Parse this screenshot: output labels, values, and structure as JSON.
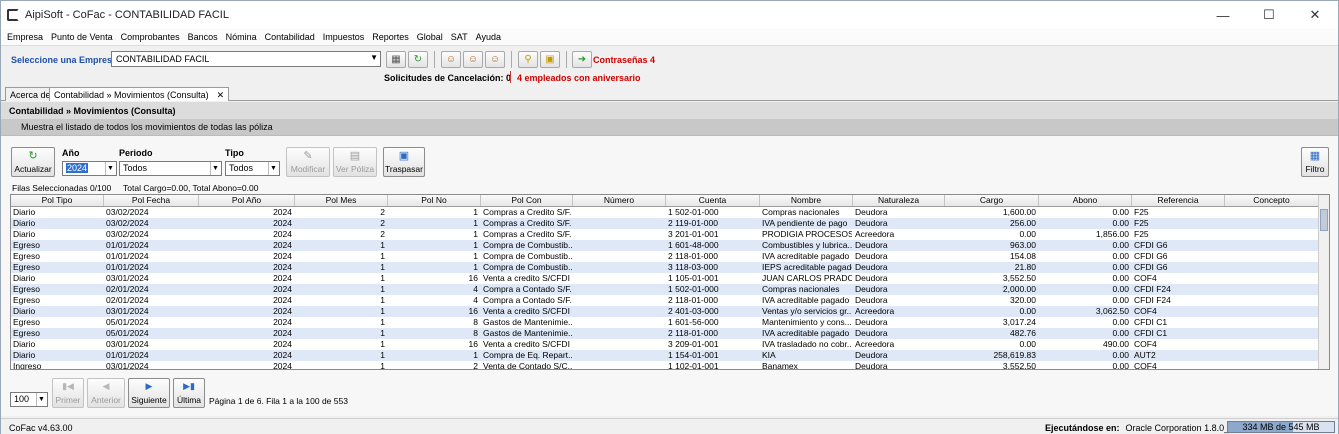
{
  "window": {
    "title": "AipiSoft - CoFac - CONTABILIDAD FACIL",
    "minimize_icon": "minimize-icon",
    "maximize_icon": "maximize-icon",
    "close_icon": "close-icon"
  },
  "menu": [
    "Empresa",
    "Punto de Venta",
    "Comprobantes",
    "Bancos",
    "Nómina",
    "Contabilidad",
    "Impuestos",
    "Reportes",
    "Global",
    "SAT",
    "Ayuda"
  ],
  "empresa": {
    "label": "Seleccione una Empresa",
    "selected": "CONTABILIDAD FACIL"
  },
  "contrasenas": "Contraseñas 4",
  "solicitudes": "Solicitudes de Cancelación: 0",
  "aniversario": "4 empleados con aniversario",
  "tabs": {
    "about": "Acerca de",
    "active": "Contabilidad » Movimientos (Consulta)",
    "close": "✕"
  },
  "header": {
    "title": "Contabilidad » Movimientos (Consulta)",
    "desc": "Muestra el listado de todos los movimientos de todas las póliza"
  },
  "filters": {
    "anio_label": "Año",
    "anio_value": "2024",
    "periodo_label": "Periodo",
    "periodo_value": "Todos",
    "tipo_label": "Tipo",
    "tipo_value": "Todos"
  },
  "buttons": {
    "actualizar": "Actualizar",
    "modificar": "Modificar",
    "ver_poliza": "Ver Póliza",
    "traspasar": "Traspasar",
    "filtro": "Filtro"
  },
  "status": {
    "filas": "Filas Seleccionadas 0/100",
    "totales": "Total Cargo=0.00, Total Abono=0.00"
  },
  "columns": [
    "Pol Tipo",
    "Pol Fecha",
    "Pol Año",
    "Pol Mes",
    "Pol No",
    "Pol Con",
    "Número",
    "Cuenta",
    "Nombre",
    "Naturaleza",
    "Cargo",
    "Abono",
    "Referencia",
    "Concepto"
  ],
  "rows": [
    [
      "Diario",
      "03/02/2024",
      "2024",
      "2",
      "1",
      "Compras a Credito S/F...",
      "",
      "1 502-01-000",
      "Compras nacionales",
      "Deudora",
      "1,600.00",
      "0.00",
      "F25",
      ""
    ],
    [
      "Diario",
      "03/02/2024",
      "2024",
      "2",
      "1",
      "Compras a Credito S/F...",
      "",
      "2 119-01-000",
      "IVA pendiente de pago",
      "Deudora",
      "256.00",
      "0.00",
      "F25",
      ""
    ],
    [
      "Diario",
      "03/02/2024",
      "2024",
      "2",
      "1",
      "Compras a Credito S/F...",
      "",
      "3 201-01-001",
      "PRODIGIA PROCESOS ...",
      "Acreedora",
      "0.00",
      "1,856.00",
      "F25",
      ""
    ],
    [
      "Egreso",
      "01/01/2024",
      "2024",
      "1",
      "1",
      "Compra de Combustib...",
      "",
      "1 601-48-000",
      "Combustibles y lubrica...",
      "Deudora",
      "963.00",
      "0.00",
      "CFDI G6",
      ""
    ],
    [
      "Egreso",
      "01/01/2024",
      "2024",
      "1",
      "1",
      "Compra de Combustib...",
      "",
      "2 118-01-000",
      "IVA acreditable pagado",
      "Deudora",
      "154.08",
      "0.00",
      "CFDI G6",
      ""
    ],
    [
      "Egreso",
      "01/01/2024",
      "2024",
      "1",
      "1",
      "Compra de Combustib...",
      "",
      "3 118-03-000",
      "IEPS acreditable pagado",
      "Deudora",
      "21.80",
      "0.00",
      "CFDI G6",
      ""
    ],
    [
      "Diario",
      "03/01/2024",
      "2024",
      "1",
      "16",
      "Venta a credito S/CFDI ...",
      "",
      "1 105-01-001",
      "JUAN CARLOS PRADO ...",
      "Deudora",
      "3,552.50",
      "0.00",
      "COF4",
      ""
    ],
    [
      "Egreso",
      "02/01/2024",
      "2024",
      "1",
      "4",
      "Compra a Contado S/F...",
      "",
      "1 502-01-000",
      "Compras nacionales",
      "Deudora",
      "2,000.00",
      "0.00",
      "CFDI F24",
      ""
    ],
    [
      "Egreso",
      "02/01/2024",
      "2024",
      "1",
      "4",
      "Compra a Contado S/F...",
      "",
      "2 118-01-000",
      "IVA acreditable pagado",
      "Deudora",
      "320.00",
      "0.00",
      "CFDI F24",
      ""
    ],
    [
      "Diario",
      "03/01/2024",
      "2024",
      "1",
      "16",
      "Venta a credito S/CFDI ...",
      "",
      "2 401-03-000",
      "Ventas y/o servicios gr...",
      "Acreedora",
      "0.00",
      "3,062.50",
      "COF4",
      ""
    ],
    [
      "Egreso",
      "05/01/2024",
      "2024",
      "1",
      "8",
      "Gastos de Mantenimie...",
      "",
      "1 601-56-000",
      "Mantenimiento y cons...",
      "Deudora",
      "3,017.24",
      "0.00",
      "CFDI C1",
      ""
    ],
    [
      "Egreso",
      "05/01/2024",
      "2024",
      "1",
      "8",
      "Gastos de Mantenimie...",
      "",
      "2 118-01-000",
      "IVA acreditable pagado",
      "Deudora",
      "482.76",
      "0.00",
      "CFDI C1",
      ""
    ],
    [
      "Diario",
      "03/01/2024",
      "2024",
      "1",
      "16",
      "Venta a credito S/CFDI ...",
      "",
      "3 209-01-001",
      "IVA trasladado no cobr...",
      "Acreedora",
      "0.00",
      "490.00",
      "COF4",
      ""
    ],
    [
      "Diario",
      "01/01/2024",
      "2024",
      "1",
      "1",
      "Compra de Eq. Repart...",
      "",
      "1 154-01-001",
      "KIA",
      "Deudora",
      "258,619.83",
      "0.00",
      "AUT2",
      ""
    ],
    [
      "Ingreso",
      "03/01/2024",
      "2024",
      "1",
      "2",
      "Venta de Contado S/C...",
      "",
      "1 102-01-001",
      "Banamex",
      "Deudora",
      "3,552.50",
      "0.00",
      "COF4",
      ""
    ]
  ],
  "pager": {
    "size": "100",
    "primer": "Primer",
    "anterior": "Anterior",
    "siguiente": "Siguiente",
    "ultima": "Última",
    "info": "Página 1 de 6. Fila 1 a la 100 de 553"
  },
  "statusbar": {
    "version": "CoFac v4.63.00",
    "running_label": "Ejecutándose en:",
    "running_value": "Oracle Corporation 1.8.0_491",
    "memory": "334 MB de 545 MB",
    "memory_fraction": 0.61
  }
}
